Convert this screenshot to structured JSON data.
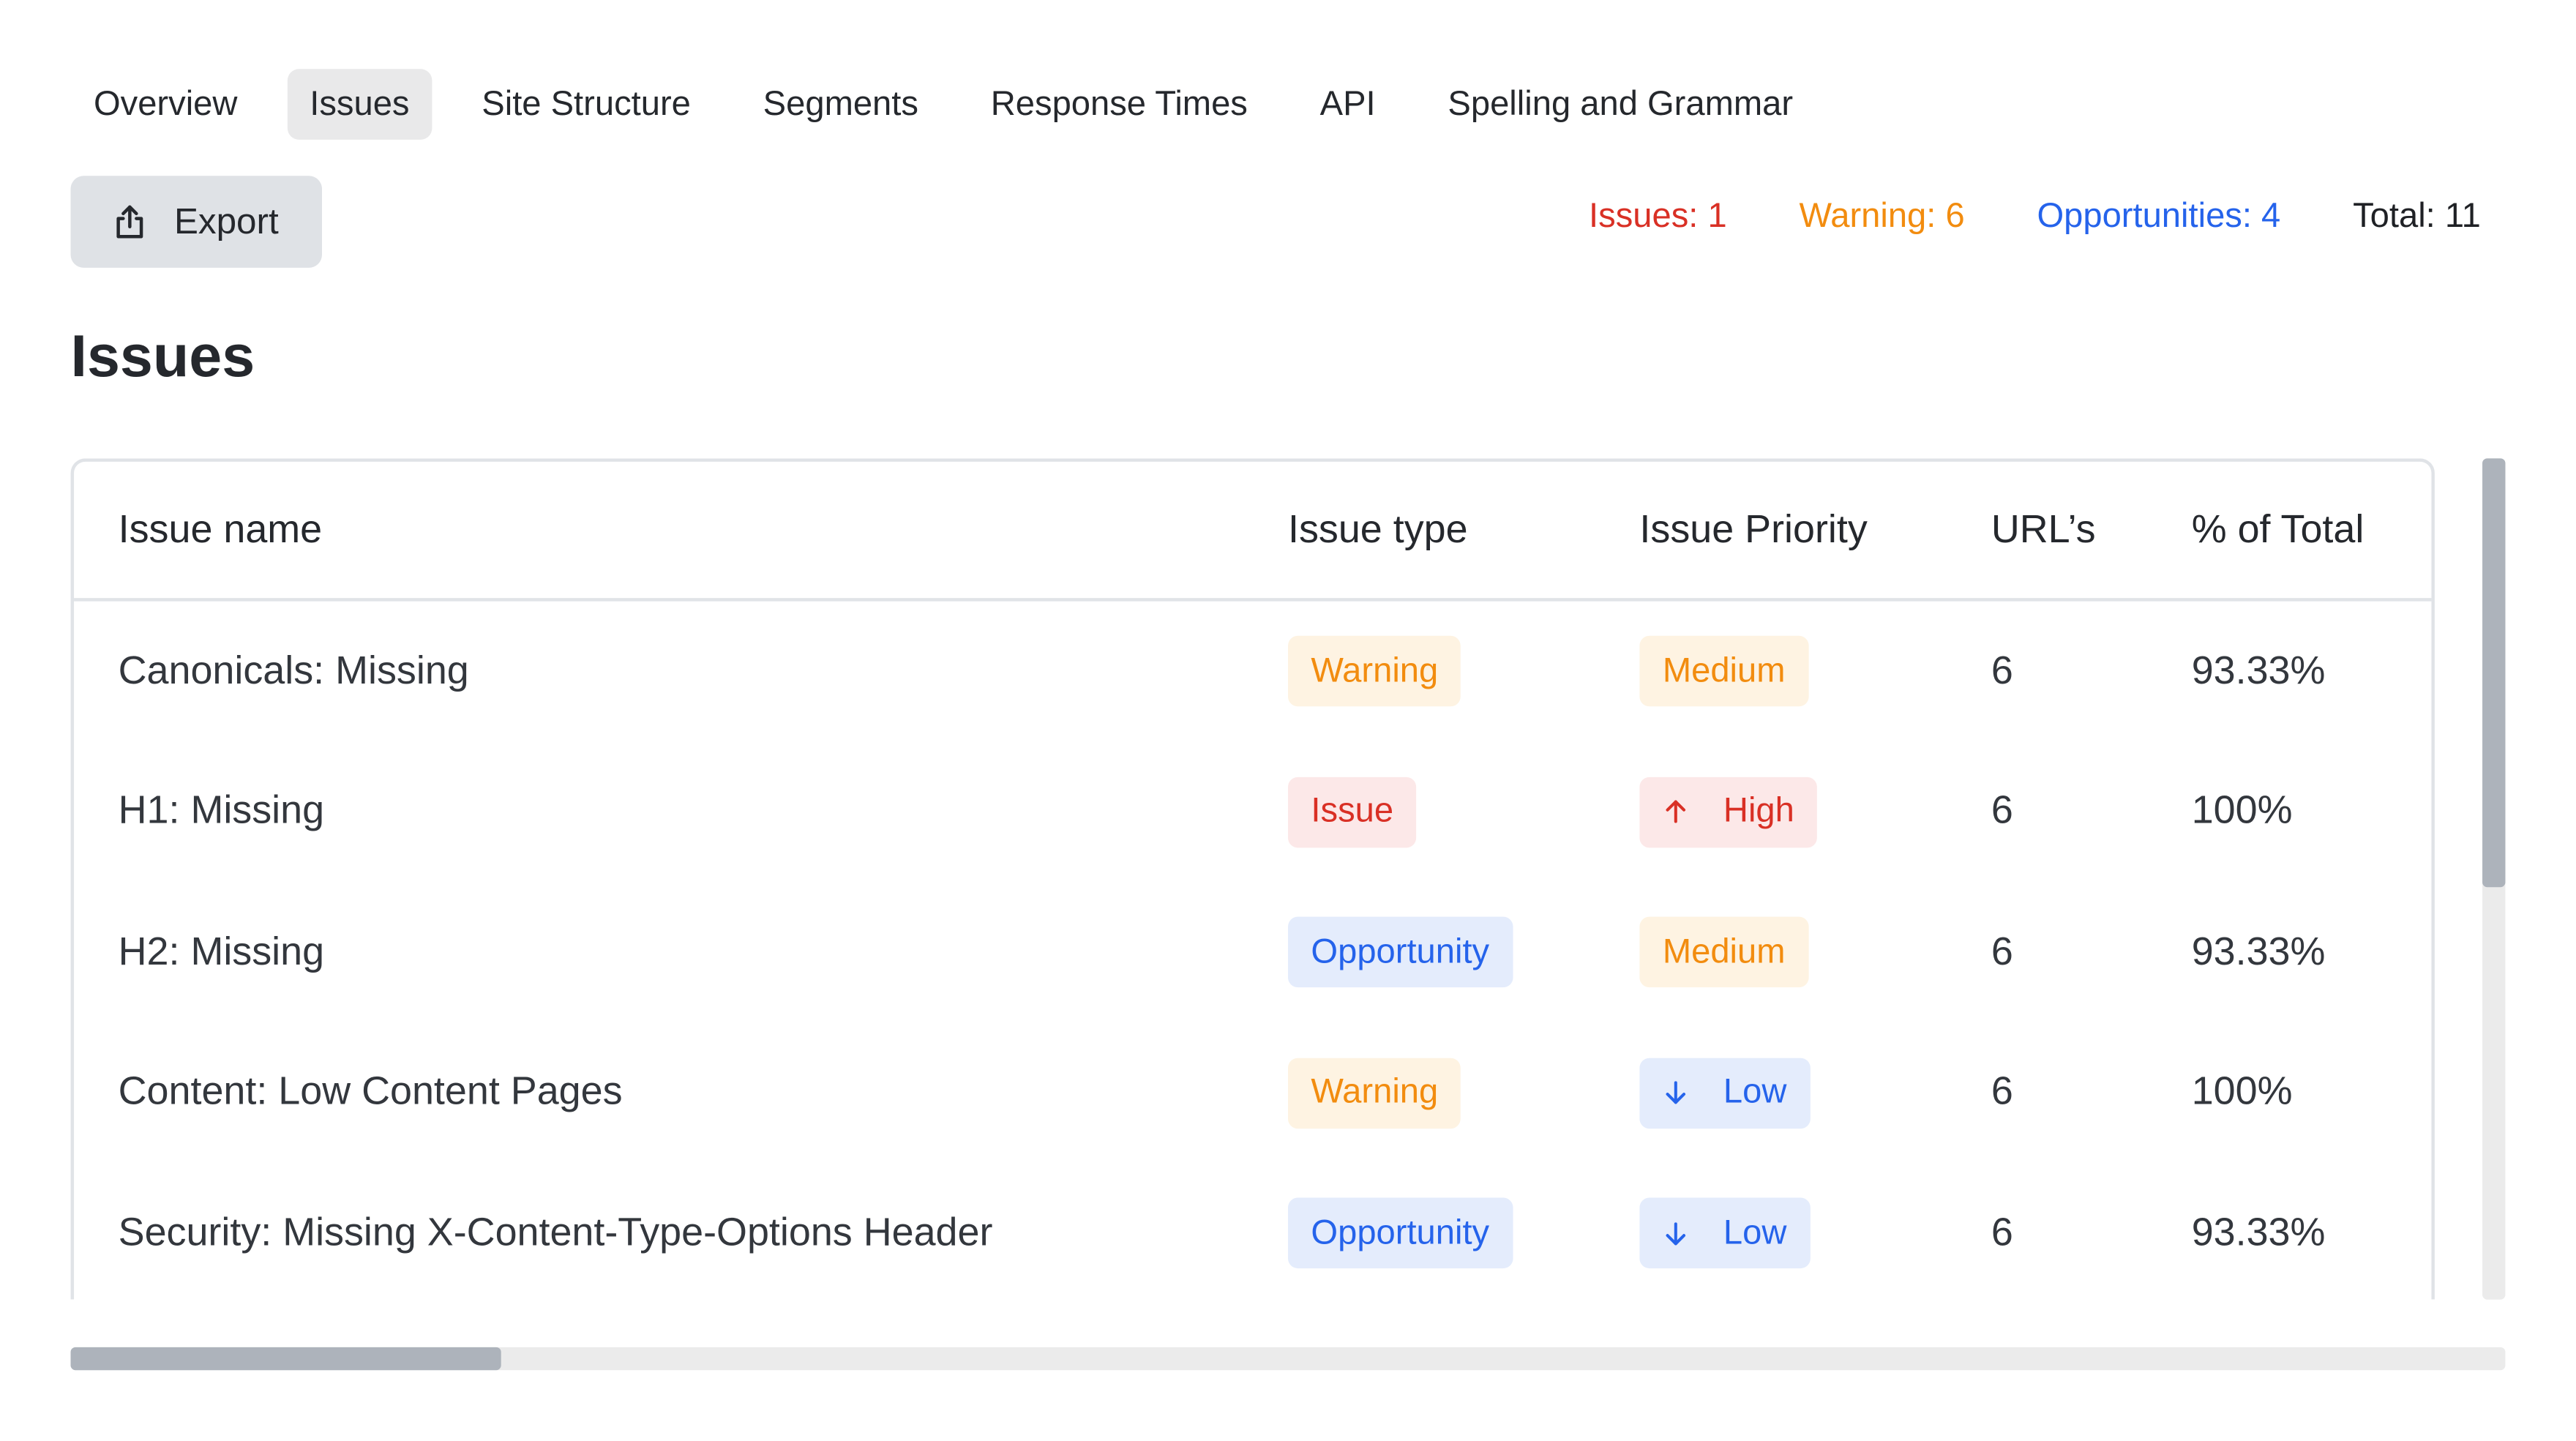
{
  "tabs": [
    {
      "label": "Overview",
      "active": false
    },
    {
      "label": "Issues",
      "active": true
    },
    {
      "label": "Site Structure",
      "active": false
    },
    {
      "label": "Segments",
      "active": false
    },
    {
      "label": "Response Times",
      "active": false
    },
    {
      "label": "API",
      "active": false
    },
    {
      "label": "Spelling and Grammar",
      "active": false
    }
  ],
  "toolbar": {
    "export_label": "Export",
    "export_icon": "share-upload-icon"
  },
  "counts": {
    "issues": {
      "label": "Issues: 1",
      "color": "#d93025"
    },
    "warning": {
      "label": "Warning: 6",
      "color": "#f28c0f"
    },
    "opportunities": {
      "label": "Opportunities: 4",
      "color": "#2563eb"
    },
    "total": {
      "label": "Total: 11",
      "color": "#1f2125"
    }
  },
  "page_title": "Issues",
  "table": {
    "columns": [
      "Issue name",
      "Issue type",
      "Issue Priority",
      "URL’s",
      "% of Total"
    ],
    "rows": [
      {
        "name": "Canonicals: Missing",
        "type": "Warning",
        "priority": "Medium",
        "priority_icon": "",
        "urls": "6",
        "percent": "93.33%"
      },
      {
        "name": "H1: Missing",
        "type": "Issue",
        "priority": "High",
        "priority_icon": "arrow-up-icon",
        "urls": "6",
        "percent": "100%"
      },
      {
        "name": "H2: Missing",
        "type": "Opportunity",
        "priority": "Medium",
        "priority_icon": "",
        "urls": "6",
        "percent": "93.33%"
      },
      {
        "name": "Content: Low Content Pages",
        "type": "Warning",
        "priority": "Low",
        "priority_icon": "arrow-down-icon",
        "urls": "6",
        "percent": "100%"
      },
      {
        "name": "Security: Missing X-Content-Type-Options Header",
        "type": "Opportunity",
        "priority": "Low",
        "priority_icon": "arrow-down-icon",
        "urls": "6",
        "percent": "93.33%"
      }
    ]
  },
  "badge_styles": {
    "Warning": {
      "fg": "#f28c0f",
      "bg": "#fef3e2"
    },
    "Issue": {
      "fg": "#d93025",
      "bg": "#fce8e8"
    },
    "Opportunity": {
      "fg": "#2563eb",
      "bg": "#e4ecfc"
    },
    "Medium": {
      "fg": "#f28c0f",
      "bg": "#fef3e2"
    },
    "High": {
      "fg": "#d93025",
      "bg": "#fce8e8"
    },
    "Low": {
      "fg": "#2563eb",
      "bg": "#e4ecfc"
    }
  },
  "scroll": {
    "vertical_thumb_fraction": 0.51,
    "horizontal_thumb_fraction": 0.177
  }
}
